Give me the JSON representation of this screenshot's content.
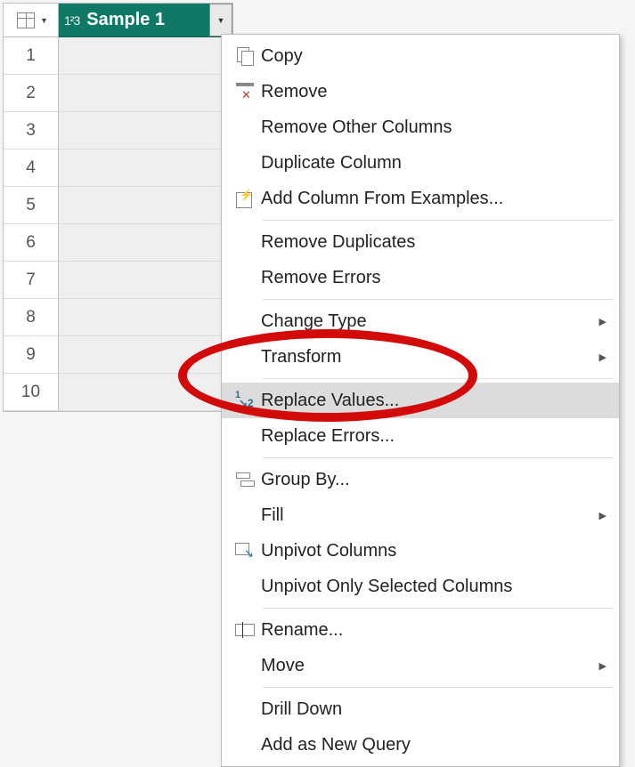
{
  "column": {
    "name": "Sample 1",
    "datatype_label": "1²3",
    "row_numbers": [
      "1",
      "2",
      "3",
      "4",
      "5",
      "6",
      "7",
      "8",
      "9",
      "10"
    ]
  },
  "menu": {
    "groups": [
      [
        {
          "id": "copy",
          "label": "Copy",
          "icon": "copy-icon",
          "submenu": false,
          "hover": false
        },
        {
          "id": "remove",
          "label": "Remove",
          "icon": "remove-icon",
          "submenu": false,
          "hover": false
        },
        {
          "id": "remove-other",
          "label": "Remove Other Columns",
          "icon": "",
          "submenu": false,
          "hover": false
        },
        {
          "id": "duplicate",
          "label": "Duplicate Column",
          "icon": "",
          "submenu": false,
          "hover": false
        },
        {
          "id": "add-col-examples",
          "label": "Add Column From Examples...",
          "icon": "addex-icon",
          "submenu": false,
          "hover": false
        }
      ],
      [
        {
          "id": "remove-dupes",
          "label": "Remove Duplicates",
          "icon": "",
          "submenu": false,
          "hover": false
        },
        {
          "id": "remove-errors",
          "label": "Remove Errors",
          "icon": "",
          "submenu": false,
          "hover": false
        }
      ],
      [
        {
          "id": "change-type",
          "label": "Change Type",
          "icon": "",
          "submenu": true,
          "hover": false
        },
        {
          "id": "transform",
          "label": "Transform",
          "icon": "",
          "submenu": true,
          "hover": false
        }
      ],
      [
        {
          "id": "replace-values",
          "label": "Replace Values...",
          "icon": "replace-icon",
          "submenu": false,
          "hover": true
        },
        {
          "id": "replace-errors",
          "label": "Replace Errors...",
          "icon": "",
          "submenu": false,
          "hover": false
        }
      ],
      [
        {
          "id": "group-by",
          "label": "Group By...",
          "icon": "group-icon",
          "submenu": false,
          "hover": false
        },
        {
          "id": "fill",
          "label": "Fill",
          "icon": "",
          "submenu": true,
          "hover": false
        },
        {
          "id": "unpivot",
          "label": "Unpivot Columns",
          "icon": "unpivot-icon",
          "submenu": false,
          "hover": false
        },
        {
          "id": "unpivot-selected",
          "label": "Unpivot Only Selected Columns",
          "icon": "",
          "submenu": false,
          "hover": false
        }
      ],
      [
        {
          "id": "rename",
          "label": "Rename...",
          "icon": "rename-icon",
          "submenu": false,
          "hover": false
        },
        {
          "id": "move",
          "label": "Move",
          "icon": "",
          "submenu": true,
          "hover": false
        }
      ],
      [
        {
          "id": "drill-down",
          "label": "Drill Down",
          "icon": "",
          "submenu": false,
          "hover": false
        },
        {
          "id": "add-new-query",
          "label": "Add as New Query",
          "icon": "",
          "submenu": false,
          "hover": false
        }
      ]
    ]
  }
}
